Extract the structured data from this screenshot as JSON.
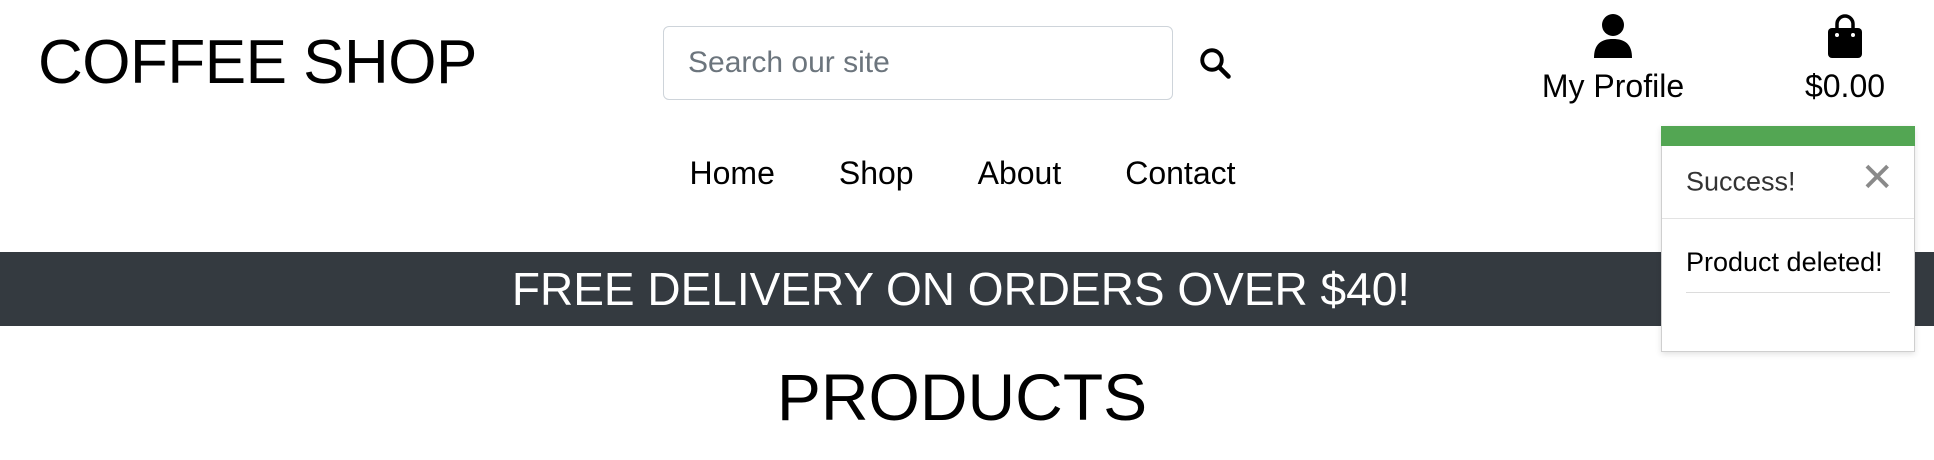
{
  "header": {
    "brand": "COFFEE SHOP",
    "search": {
      "placeholder": "Search our site",
      "value": "",
      "icon": "search-icon"
    },
    "profile": {
      "label": "My Profile",
      "icon": "user-icon"
    },
    "bag": {
      "total": "$0.00",
      "icon": "shopping-bag-icon"
    }
  },
  "nav": {
    "items": [
      {
        "label": "Home"
      },
      {
        "label": "Shop"
      },
      {
        "label": "About"
      },
      {
        "label": "Contact"
      }
    ]
  },
  "banner": {
    "text": "FREE DELIVERY ON ORDERS OVER $40!"
  },
  "main": {
    "title": "PRODUCTS"
  },
  "toast": {
    "title": "Success!",
    "close_glyph": "✕",
    "message": "Product deleted!",
    "accent_color": "#53a653"
  },
  "colors": {
    "banner_bg": "#343a40",
    "banner_text": "#ffffff",
    "toast_accent": "#53a653"
  }
}
